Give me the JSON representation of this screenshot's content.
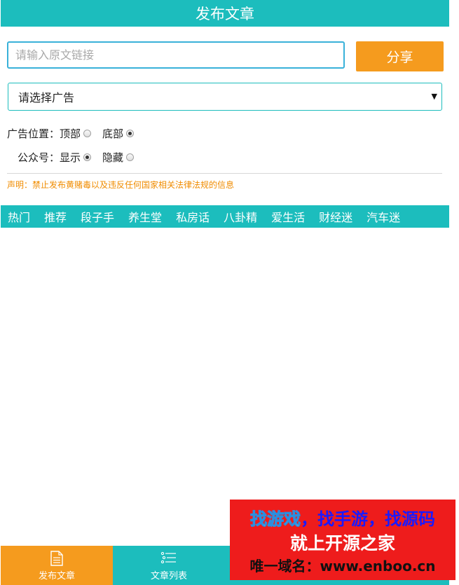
{
  "header": {
    "title": "发布文章"
  },
  "form": {
    "url_placeholder": "请输入原文链接",
    "share_label": "分享",
    "ad_select_value": "请选择广告",
    "ad_position": {
      "label": "广告位置：",
      "options": [
        "顶部",
        "底部"
      ],
      "selected": "底部"
    },
    "account": {
      "label": "公众号：",
      "options": [
        "显示",
        "隐藏"
      ],
      "selected": "显示"
    },
    "notice": "声明：禁止发布黄赌毒以及违反任何国家相关法律法规的信息"
  },
  "nav": {
    "items": [
      "热门",
      "推荐",
      "段子手",
      "养生堂",
      "私房话",
      "八卦精",
      "爱生活",
      "财经迷",
      "汽车迷"
    ]
  },
  "bottom_tabs": [
    {
      "label": "发布文章",
      "icon": "document-icon",
      "active": true
    },
    {
      "label": "文章列表",
      "icon": "list-icon",
      "active": false
    }
  ],
  "promo": {
    "part1": "找游戏",
    "part2": "，找手游，找源码",
    "line2": "就上开源之家",
    "line3": "唯一域名：www.enboo.cn"
  },
  "colors": {
    "teal": "#1cbdbd",
    "orange": "#f59b1e",
    "notice": "#f08c00",
    "promo_red": "#ee1c1c"
  }
}
